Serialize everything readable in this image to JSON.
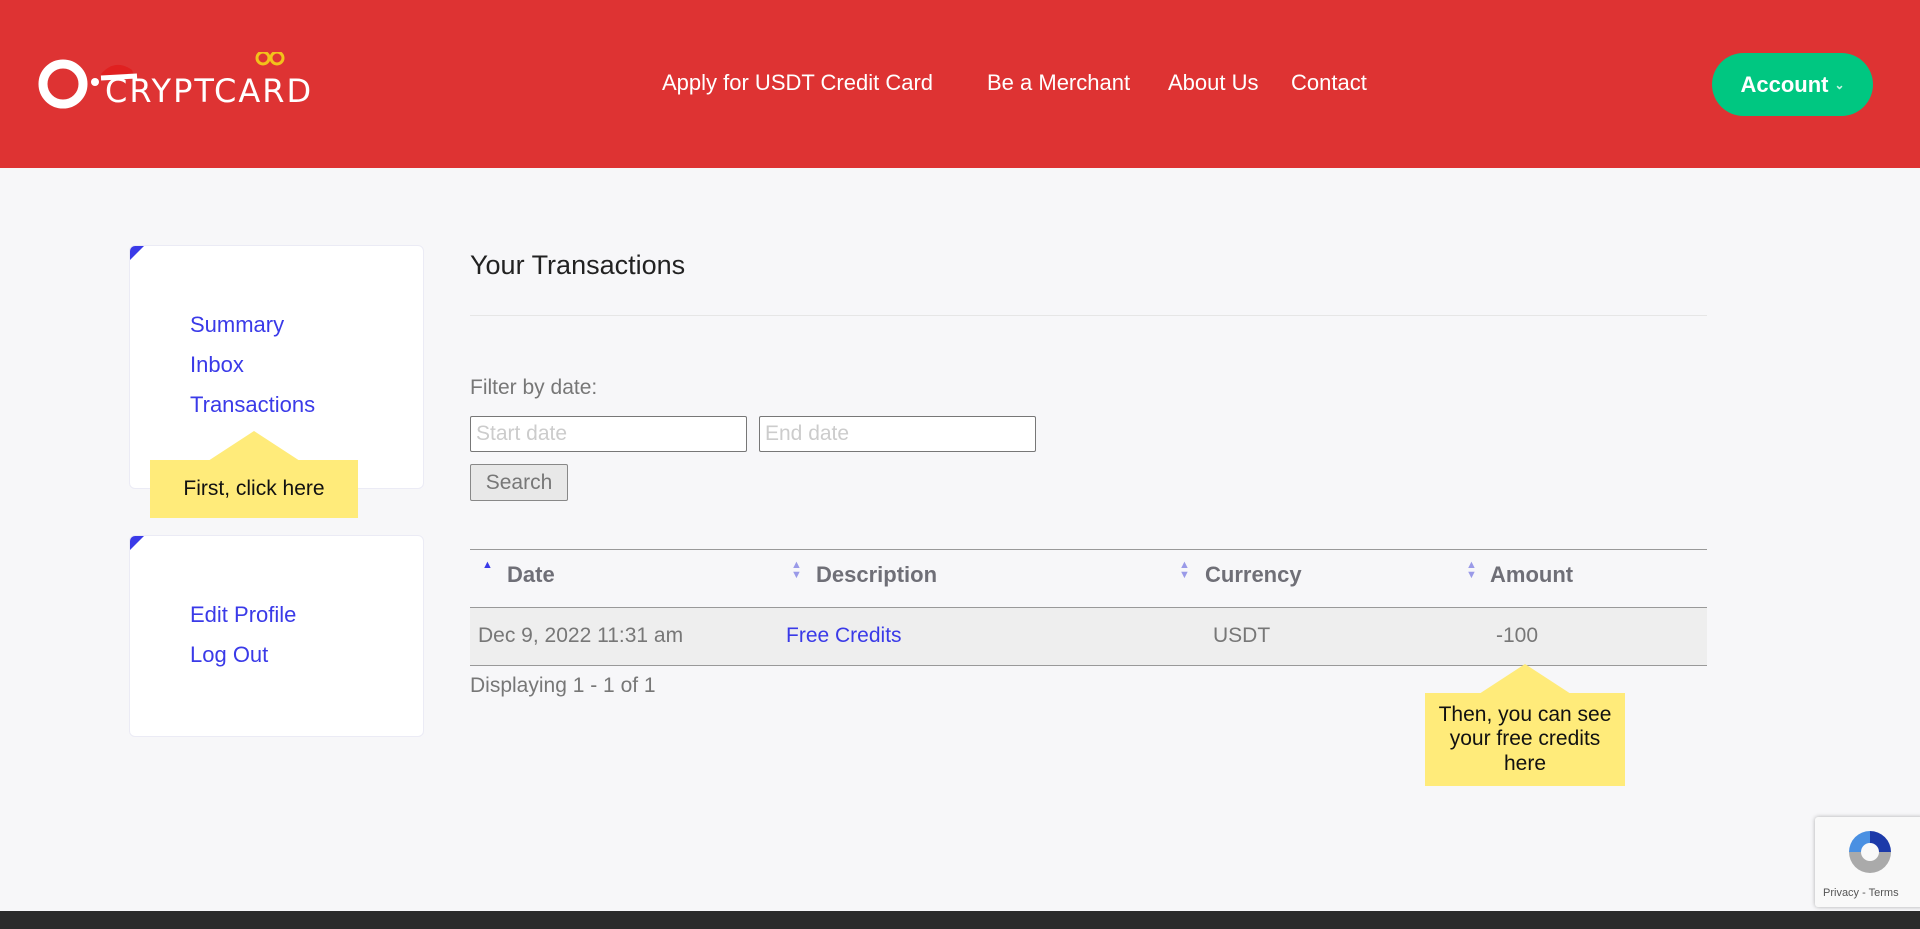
{
  "brand": {
    "name": "CRYPTCARD",
    "color": "#de3333"
  },
  "nav": {
    "items": [
      "Apply for USDT Credit Card",
      "Be a Merchant",
      "About Us",
      "Contact"
    ],
    "account": "Account"
  },
  "sidebar": {
    "group1": [
      "Summary",
      "Inbox",
      "Transactions"
    ],
    "group2": [
      "Edit Profile",
      "Log Out"
    ]
  },
  "tooltips": {
    "first": "First, click here",
    "second": "Then, you can see your free credits here"
  },
  "main": {
    "title": "Your Transactions",
    "filter_label": "Filter by date:",
    "start_placeholder": "Start date",
    "end_placeholder": "End date",
    "search": "Search"
  },
  "table": {
    "headers": [
      "Date",
      "Description",
      "Currency",
      "Amount"
    ],
    "sorted": "Date",
    "rows": [
      {
        "date": "Dec 9, 2022 11:31 am",
        "description": "Free Credits",
        "currency": "USDT",
        "amount": "-100"
      }
    ],
    "footer": "Displaying 1 - 1 of 1"
  },
  "recaptcha": {
    "links": "Privacy - Terms"
  },
  "colors": {
    "header": "#de3333",
    "account": "#00c781",
    "link": "#3a3ae8",
    "tooltip": "#ffeb7a"
  }
}
